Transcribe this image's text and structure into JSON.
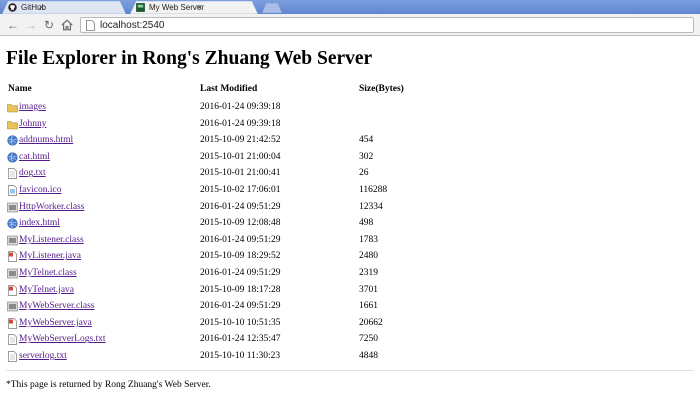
{
  "browser": {
    "tabs": [
      {
        "label": "GitHub",
        "icon": "github-icon"
      },
      {
        "label": "My Web Server",
        "icon": "page-icon"
      }
    ],
    "url": "localhost:2540"
  },
  "page": {
    "title": "File Explorer in Rong's Zhuang Web Server",
    "columns": {
      "name": "Name",
      "modified": "Last Modified",
      "size": "Size(Bytes)"
    },
    "files": [
      {
        "name": "images",
        "modified": "2016-01-24 09:39:18",
        "size": "",
        "icon": "folder-icon"
      },
      {
        "name": "Johnny",
        "modified": "2016-01-24 09:39:18",
        "size": "",
        "icon": "folder-icon"
      },
      {
        "name": "addnums.html",
        "modified": "2015-10-09 21:42:52",
        "size": "454",
        "icon": "html-file-icon"
      },
      {
        "name": "cat.html",
        "modified": "2015-10-01 21:00:04",
        "size": "302",
        "icon": "html-file-icon"
      },
      {
        "name": "dog.txt",
        "modified": "2015-10-01 21:00:41",
        "size": "26",
        "icon": "text-file-icon"
      },
      {
        "name": "favicon.ico",
        "modified": "2015-10-02 17:06:01",
        "size": "116288",
        "icon": "image-file-icon"
      },
      {
        "name": "HttpWorker.class",
        "modified": "2016-01-24 09:51:29",
        "size": "12334",
        "icon": "class-file-icon"
      },
      {
        "name": "index.html",
        "modified": "2015-10-09 12:08:48",
        "size": "498",
        "icon": "html-file-icon"
      },
      {
        "name": "MyListener.class",
        "modified": "2016-01-24 09:51:29",
        "size": "1783",
        "icon": "class-file-icon"
      },
      {
        "name": "MyListener.java",
        "modified": "2015-10-09 18:29:52",
        "size": "2480",
        "icon": "java-file-icon"
      },
      {
        "name": "MyTelnet.class",
        "modified": "2016-01-24 09:51:29",
        "size": "2319",
        "icon": "class-file-icon"
      },
      {
        "name": "MyTelnet.java",
        "modified": "2015-10-09 18:17:28",
        "size": "3701",
        "icon": "java-file-icon"
      },
      {
        "name": "MyWebServer.class",
        "modified": "2016-01-24 09:51:29",
        "size": "1661",
        "icon": "class-file-icon"
      },
      {
        "name": "MyWebServer.java",
        "modified": "2015-10-10 10:51:35",
        "size": "20662",
        "icon": "java-file-icon"
      },
      {
        "name": "MyWebServerLogs.txt",
        "modified": "2016-01-24 12:35:47",
        "size": "7250",
        "icon": "text-file-icon"
      },
      {
        "name": "serverlog.txt",
        "modified": "2015-10-10 11:30:23",
        "size": "4848",
        "icon": "text-file-icon"
      }
    ],
    "footer": "*This page is returned by Rong Zhuang's Web Server."
  },
  "colors": {
    "link_visited": "#551a8b",
    "titlebar": "#6b8fd4",
    "folder": "#e8c25a"
  }
}
